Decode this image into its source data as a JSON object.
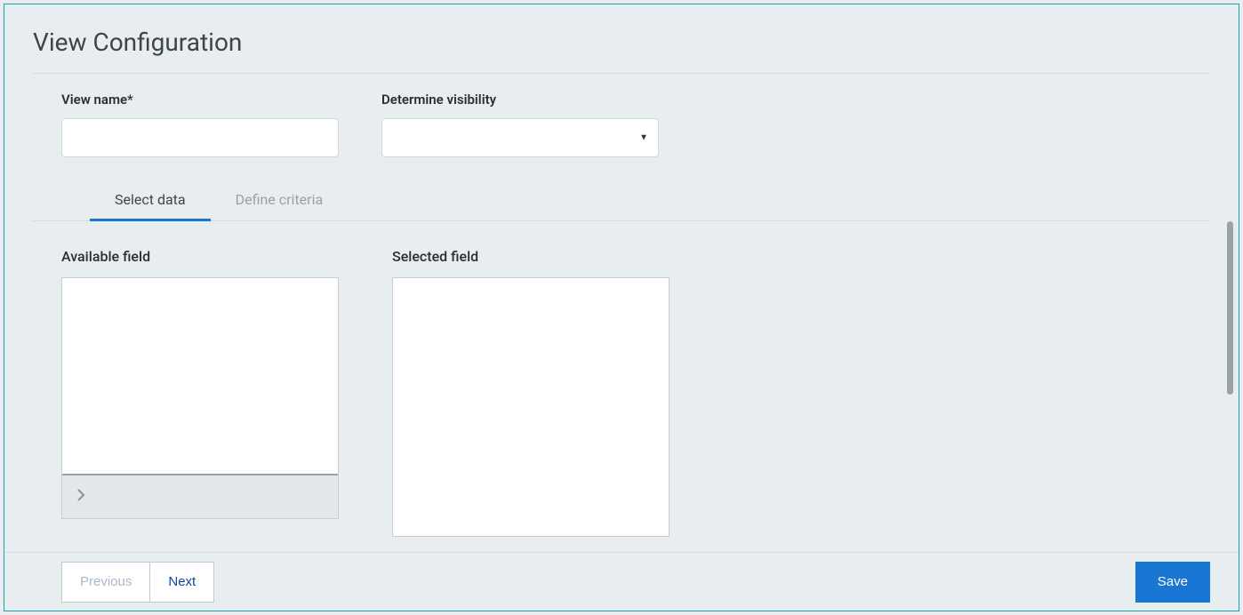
{
  "panel": {
    "title": "View Configuration"
  },
  "form": {
    "viewName": {
      "label": "View name*",
      "value": ""
    },
    "visibility": {
      "label": "Determine visibility",
      "value": ""
    }
  },
  "tabs": {
    "selectData": "Select data",
    "defineCriteria": "Define criteria"
  },
  "fields": {
    "available": {
      "label": "Available field"
    },
    "selected": {
      "label": "Selected field"
    }
  },
  "footer": {
    "previous": "Previous",
    "next": "Next",
    "save": "Save"
  }
}
